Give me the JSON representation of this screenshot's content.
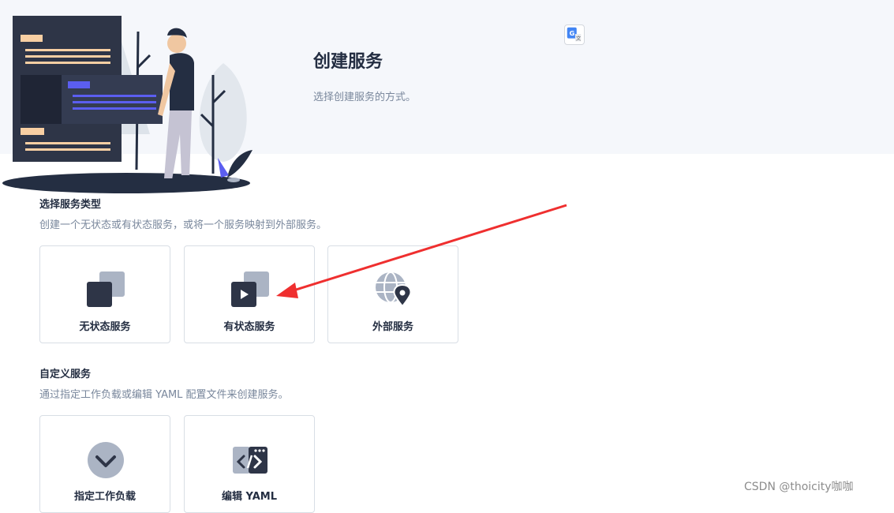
{
  "header": {
    "title": "创建服务",
    "description": "选择创建服务的方式。"
  },
  "service_type_section": {
    "title": "选择服务类型",
    "description": "创建一个无状态或有状态服务，或将一个服务映射到外部服务。",
    "cards": [
      {
        "label": "无状态服务",
        "icon": "stateless-service-icon"
      },
      {
        "label": "有状态服务",
        "icon": "stateful-service-icon"
      },
      {
        "label": "外部服务",
        "icon": "external-service-icon"
      }
    ]
  },
  "custom_section": {
    "title": "自定义服务",
    "description": "通过指定工作负载或编辑 YAML 配置文件来创建服务。",
    "cards": [
      {
        "label": "指定工作负载",
        "icon": "check-circle-icon"
      },
      {
        "label": "编辑 YAML",
        "icon": "code-edit-icon"
      }
    ]
  },
  "watermark": "CSDN @thoicity咖咖",
  "colors": {
    "dark": "#242e42",
    "muted": "#79879c",
    "icon_light": "#abb4c4",
    "arrow": "#ef2f2f",
    "header_bg": "#f5f7fb",
    "accent": "#5b5ef0"
  }
}
